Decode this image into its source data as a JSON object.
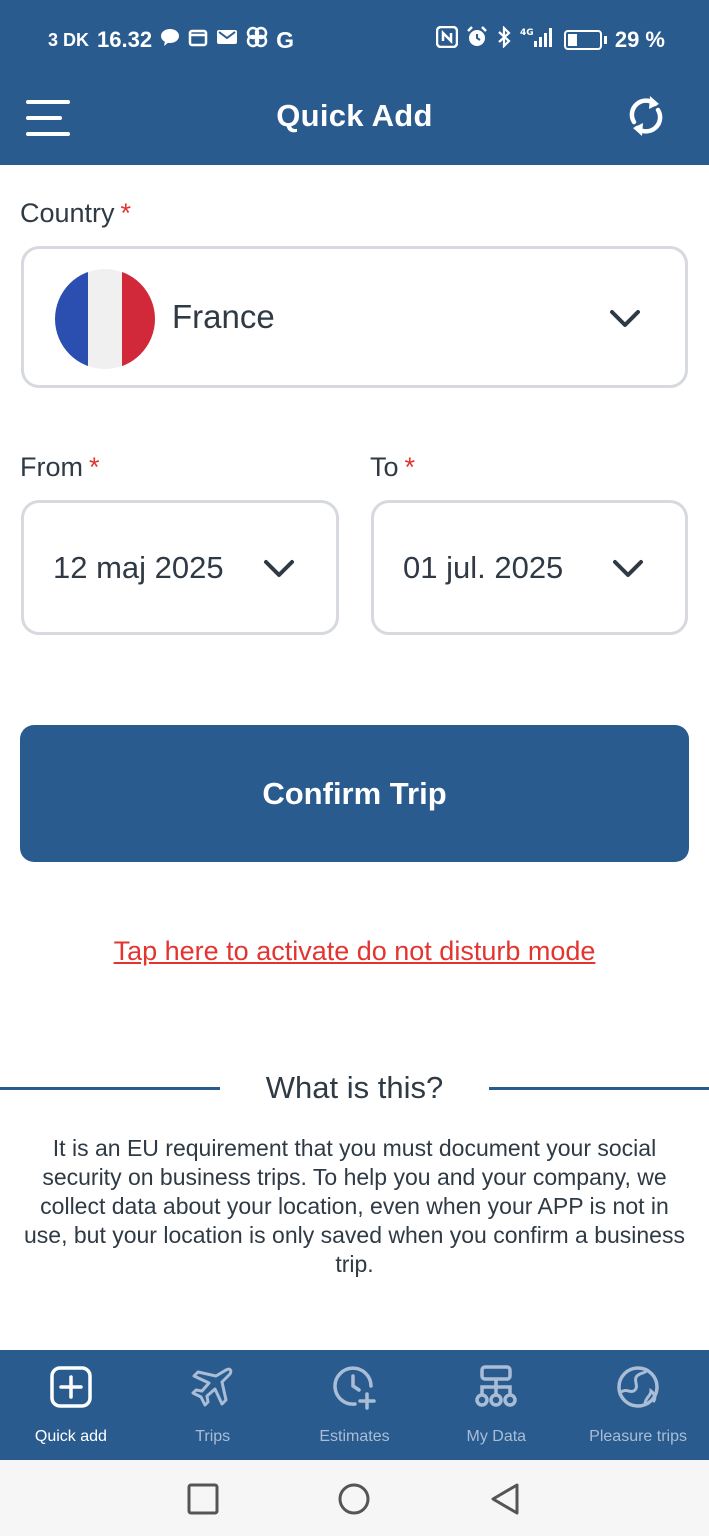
{
  "status_bar": {
    "left_prefix": "3 DK",
    "time": "16.32",
    "left_icons": [
      "chat-bubble-icon",
      "calendar-icon",
      "mail-icon",
      "fan-icon",
      "google-icon"
    ],
    "right_icons": [
      "nfc-icon",
      "alarm-icon",
      "bluetooth-icon",
      "signal-4g-icon",
      "battery-icon"
    ],
    "battery": "29 %"
  },
  "app_bar": {
    "title": "Quick Add",
    "menu_icon": "hamburger-menu-icon",
    "refresh_icon": "refresh-icon"
  },
  "form": {
    "country_label": "Country",
    "required_mark": "*",
    "country_value": "France",
    "from_label": "From",
    "from_value": "12 maj 2025",
    "to_label": "To",
    "to_value": "01 jul. 2025"
  },
  "actions": {
    "confirm_label": "Confirm Trip",
    "dnd_link": "Tap here to activate do not disturb mode"
  },
  "info": {
    "title": "What is this?",
    "body": "It is an EU requirement that you must document your social security on business trips. To help you and your company, we collect data about your location, even when your APP is not in use, but your location is only saved when you confirm a business trip."
  },
  "bottom_nav": {
    "items": [
      {
        "label": "Quick add",
        "icon": "plus-square-icon",
        "active": true
      },
      {
        "label": "Trips",
        "icon": "airplane-icon",
        "active": false
      },
      {
        "label": "Estimates",
        "icon": "clock-plus-icon",
        "active": false
      },
      {
        "label": "My Data",
        "icon": "sitemap-icon",
        "active": false
      },
      {
        "label": "Pleasure trips",
        "icon": "globe-icon",
        "active": false
      }
    ]
  },
  "colors": {
    "primary": "#2a5b8f",
    "required": "#e3342f",
    "text": "#2f3a45",
    "border": "#d6d9de",
    "flag_blue": "#2a4fb0",
    "flag_white": "#f0f0f0",
    "flag_red": "#d1293a"
  }
}
